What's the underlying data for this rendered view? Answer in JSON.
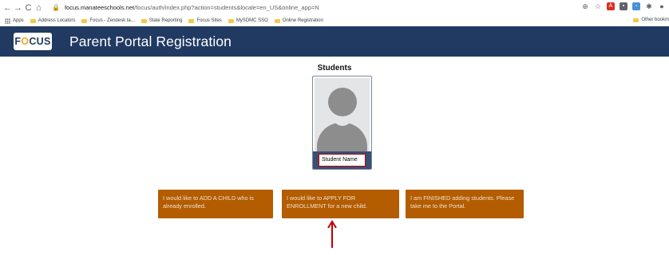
{
  "browser": {
    "url_host": "focus.manateeschools.net",
    "url_path": "/focus/auth/index.php?action=students&locale=en_US&online_app=N",
    "bookmarks": [
      {
        "label": "Apps",
        "icon": "apps-grid-icon"
      },
      {
        "label": "Address Locators",
        "icon": "folder-icon"
      },
      {
        "label": "Focus - Zendesk ta...",
        "icon": "folder-icon"
      },
      {
        "label": "State Reporting",
        "icon": "folder-icon"
      },
      {
        "label": "Focus Sites",
        "icon": "folder-icon"
      },
      {
        "label": "MySDMC SSO",
        "icon": "folder-icon"
      },
      {
        "label": "Online Registration",
        "icon": "folder-icon"
      }
    ],
    "other_bookmarks": "Other bookm"
  },
  "header": {
    "logo_pre": "F",
    "logo_o": "O",
    "logo_post": "CUS",
    "title": "Parent Portal Registration",
    "bg_color": "#213a62"
  },
  "students": {
    "heading": "Students",
    "card_name": "Student Name"
  },
  "actions": {
    "add_child": "I would like to ADD A CHILD who is already enrolled.",
    "apply_enrollment": "I would like to APPLY FOR ENROLLMENT for a new child.",
    "finished": "I am FINISHED adding students. Please take me to the Portal.",
    "button_color": "#b35c00"
  },
  "annotation": {
    "arrow_color": "#c00000"
  }
}
